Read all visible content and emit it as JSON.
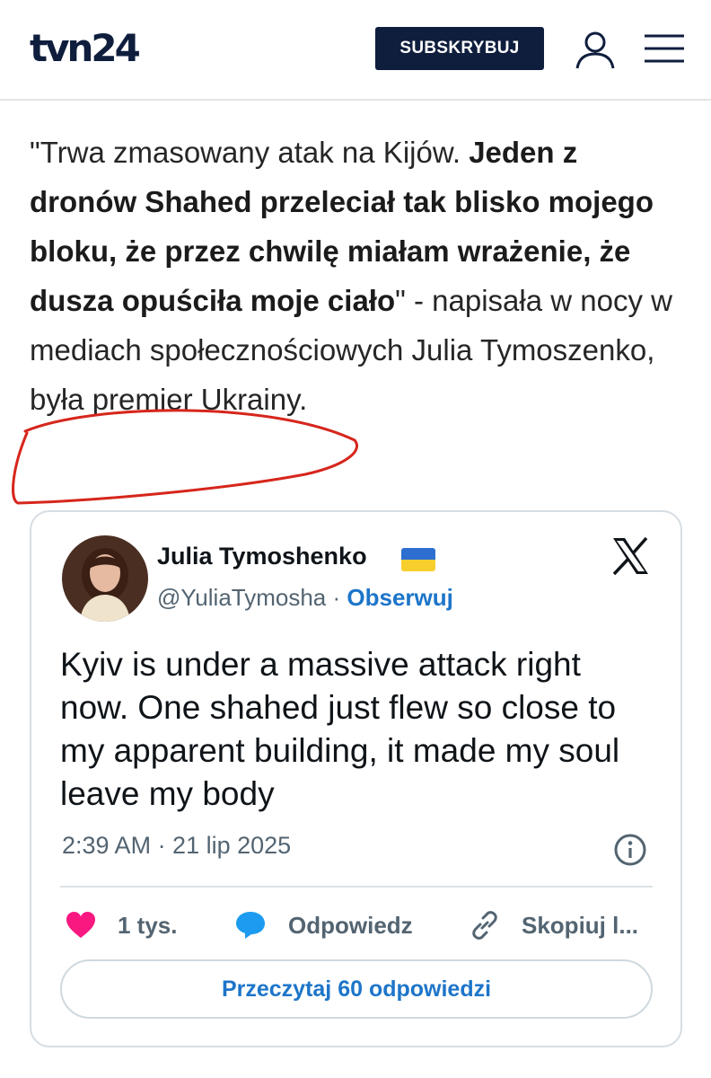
{
  "header": {
    "logo_text": "tvn24",
    "subscribe_label": "SUBSKRYBUJ",
    "user_icon": "user-icon",
    "menu_icon": "hamburger-menu-icon",
    "brand_color": "#0f1e3d"
  },
  "article": {
    "quote_open": "\"Trwa zmasowany atak na Kijów. ",
    "quote_bold": "Jeden z dronów Shahed przeleciał tak blisko mojego bloku, że przez chwilę miałam wrażenie, że dusza opuściła moje ciało",
    "quote_close": "\" - napisała w nocy w mediach społecznościowych Julia Tymoszenko, była premier Ukrainy.",
    "annotation_color": "#d6261c"
  },
  "tweet": {
    "author_name": "Julia Tymoshenko",
    "flag_icon": "ukraine-flag-icon",
    "handle": "@YuliaTymosha",
    "separator": " · ",
    "follow_label": "Obserwuj",
    "platform_icon": "x-logo-icon",
    "text": "Kyiv is under a massive attack right now. One shahed just flew so close to my apparent building, it made my soul leave my body",
    "timestamp": "2:39 AM · 21 lip 2025",
    "info_icon": "info-icon",
    "actions": {
      "like_count": "1 tys.",
      "reply_label": "Odpowiedz",
      "copy_label": "Skopiuj l..."
    },
    "read_replies_label": "Przeczytaj 60 odpowiedzi",
    "link_color": "#1d75c9",
    "like_color": "#f91880"
  }
}
